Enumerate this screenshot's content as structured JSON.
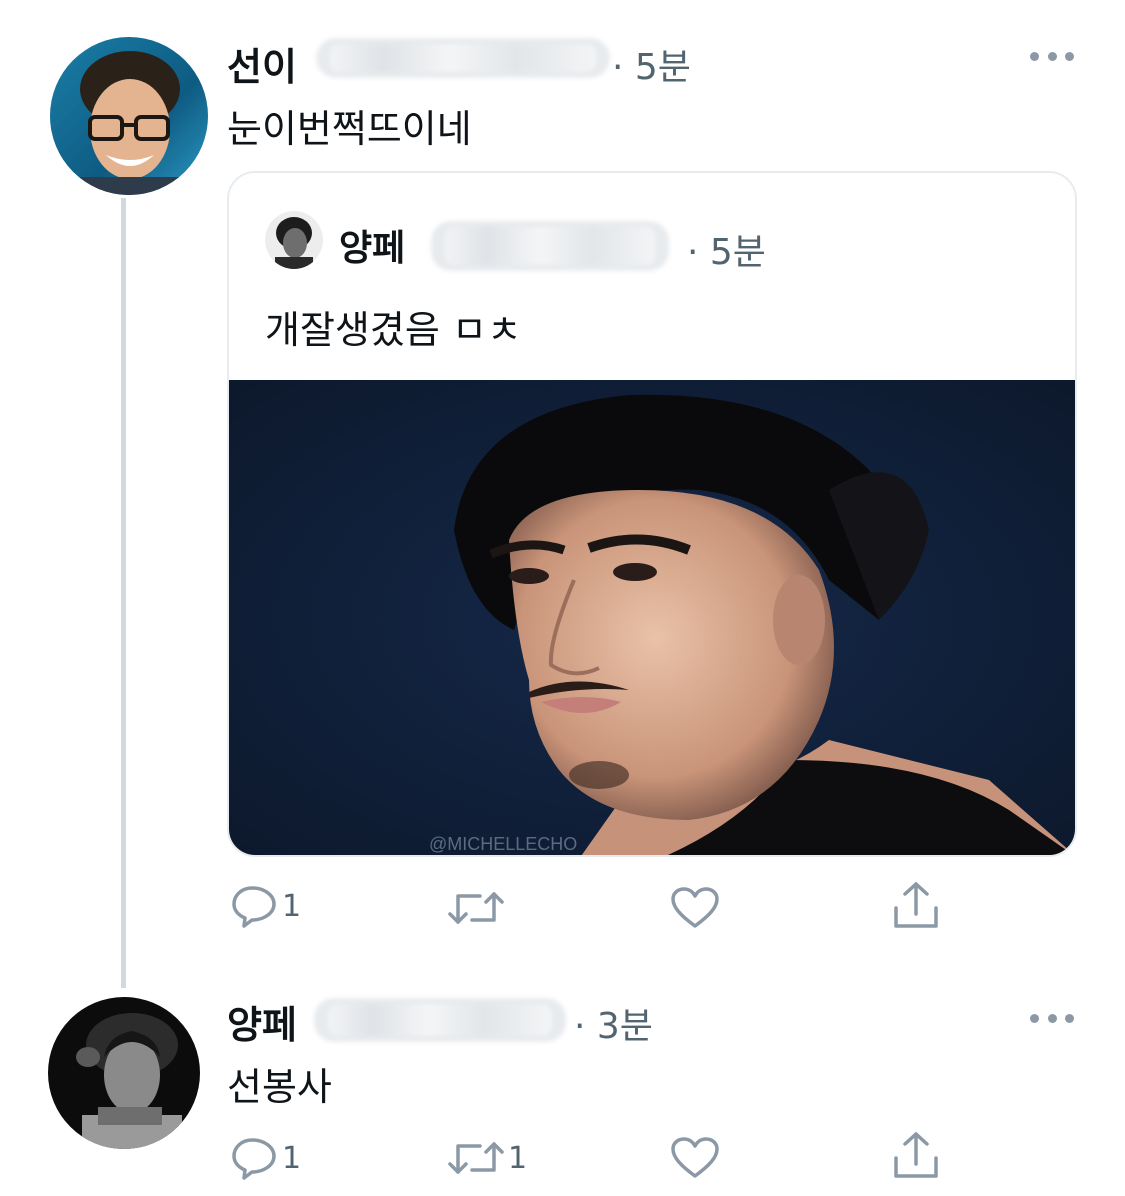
{
  "tweet1": {
    "name": "선이",
    "time": "· 5분",
    "text": "눈이번쩍뜨이네",
    "quote": {
      "name": "양페",
      "time": "· 5분",
      "text": "개잘생겼음 ㅁㅊ",
      "watermark": "@MICHELLECHO"
    },
    "actions": {
      "reply_count": "1",
      "retweet_count": "",
      "like_count": ""
    }
  },
  "tweet2": {
    "name": "양페",
    "time": "· 3분",
    "text": "선봉사",
    "actions": {
      "reply_count": "1",
      "retweet_count": "1",
      "like_count": ""
    }
  },
  "icons": {
    "reply": "reply-icon",
    "retweet": "retweet-icon",
    "like": "heart-icon",
    "share": "share-icon",
    "more": "more-icon"
  },
  "colors": {
    "text": "#0f1419",
    "secondary": "#536471",
    "icon": "#8b98a5",
    "thread_line": "#cfd9de",
    "card_border": "#e6ecf0",
    "photo_bg": "#0f1c2e"
  }
}
